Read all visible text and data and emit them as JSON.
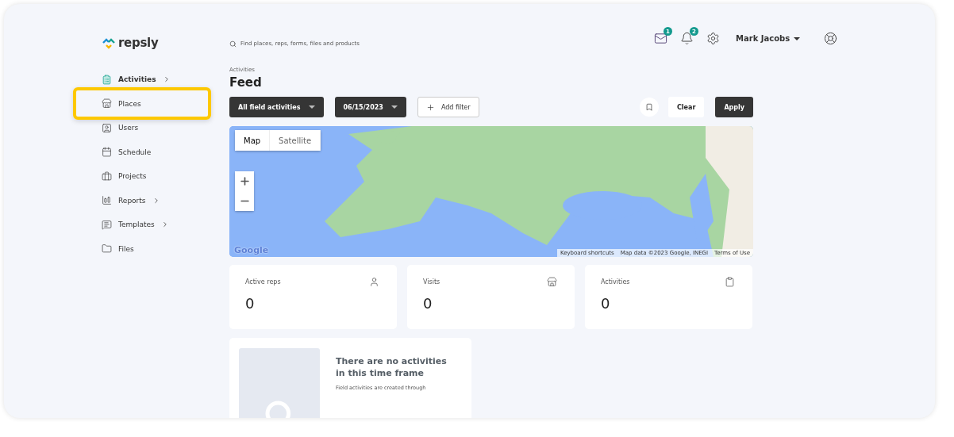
{
  "logo": {
    "text": "repsly"
  },
  "search": {
    "placeholder": "Find places, reps, forms, files and products"
  },
  "header": {
    "mail_badge": "1",
    "notification_badge": "2",
    "user_name": "Mark Jacobs"
  },
  "sidebar": {
    "items": [
      {
        "label": "Activities",
        "kind": "clipboard",
        "has_submenu": true,
        "selected": true,
        "highlighted": false
      },
      {
        "label": "Places",
        "kind": "store",
        "has_submenu": false,
        "selected": false,
        "highlighted": true
      },
      {
        "label": "Users",
        "kind": "user",
        "has_submenu": false,
        "selected": false,
        "highlighted": false
      },
      {
        "label": "Schedule",
        "kind": "calendar",
        "has_submenu": false,
        "selected": false,
        "highlighted": false
      },
      {
        "label": "Projects",
        "kind": "briefcase",
        "has_submenu": false,
        "selected": false,
        "highlighted": false
      },
      {
        "label": "Reports",
        "kind": "chart",
        "has_submenu": true,
        "selected": false,
        "highlighted": false
      },
      {
        "label": "Templates",
        "kind": "template",
        "has_submenu": true,
        "selected": false,
        "highlighted": false
      },
      {
        "label": "Files",
        "kind": "folder",
        "has_submenu": false,
        "selected": false,
        "highlighted": false
      }
    ]
  },
  "breadcrumb": "Activities",
  "title": "Feed",
  "filters": [
    {
      "label": "All field activities"
    },
    {
      "label": "06/15/2023"
    }
  ],
  "add_filter": "Add filter",
  "actions": {
    "clear": "Clear",
    "apply": "Apply"
  },
  "map": {
    "types": [
      {
        "label": "Map",
        "selected": true
      },
      {
        "label": "Satellite",
        "selected": false
      }
    ],
    "logo": "Google",
    "attribution": [
      "Keyboard shortcuts",
      "Map data ©2023 Google, INEGI",
      "Terms of Use"
    ]
  },
  "stats": [
    {
      "label": "Active reps",
      "value": "0",
      "kind": "user"
    },
    {
      "label": "Visits",
      "value": "0",
      "kind": "store"
    },
    {
      "label": "Activities",
      "value": "0",
      "kind": "clipboard"
    }
  ],
  "empty_state": {
    "title": "There are no activities in this time frame",
    "text": "Field activities are created through"
  }
}
